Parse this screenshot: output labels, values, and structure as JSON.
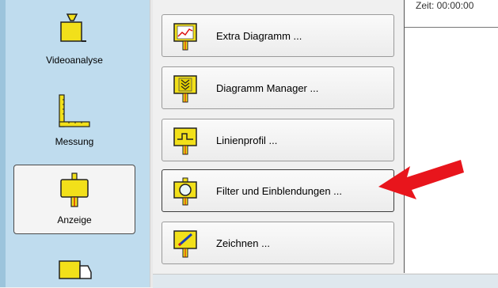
{
  "sidebar": {
    "items": [
      {
        "label": "Videoanalyse",
        "icon": "video-camera-icon"
      },
      {
        "label": "Messung",
        "icon": "ruler-measure-icon"
      },
      {
        "label": "Anzeige",
        "icon": "sign-display-icon"
      },
      {
        "label": "",
        "icon": "truck-icon"
      }
    ],
    "active_index": 2
  },
  "menu": {
    "buttons": [
      {
        "label": "Extra Diagramm ...",
        "icon": "line-chart-icon"
      },
      {
        "label": "Diagramm Manager ...",
        "icon": "diagram-manager-icon"
      },
      {
        "label": "Linienprofil ...",
        "icon": "line-profile-icon"
      },
      {
        "label": "Filter und Einblendungen ...",
        "icon": "filter-lens-icon",
        "highlighted": true
      },
      {
        "label": "Zeichnen ...",
        "icon": "pencil-draw-icon"
      }
    ]
  },
  "status": {
    "time_text": "Zeit:  00:00:00"
  },
  "colors": {
    "sidebar_bg": "#bfdcee",
    "icon_yellow": "#f2e01a",
    "arrow_red": "#e8151c"
  }
}
